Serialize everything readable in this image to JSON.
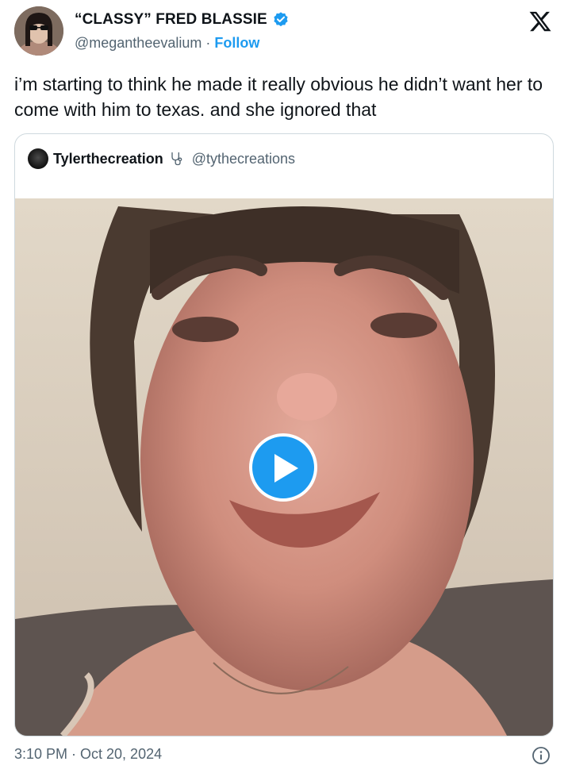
{
  "author": {
    "display_name": "“CLASSY” FRED BLASSIE",
    "handle": "@megantheevalium",
    "separator": " · ",
    "follow_label": "Follow",
    "verified_icon": "verified-badge-icon"
  },
  "tweet": {
    "text": "i’m starting to think he made it really obvious he didn’t want her to come with him to texas. and she ignored that",
    "timestamp": "3:10 PM · Oct 20, 2024"
  },
  "quoted": {
    "display_name": "Tylerthecreation",
    "name_emoji_icon": "stethoscope-icon",
    "handle": "@tythecreations"
  },
  "media": {
    "type": "video",
    "play_icon": "play-icon"
  },
  "colors": {
    "accent": "#1d9bf0",
    "text_primary": "#0f1419",
    "text_secondary": "#536471",
    "border": "#cfd9de"
  }
}
